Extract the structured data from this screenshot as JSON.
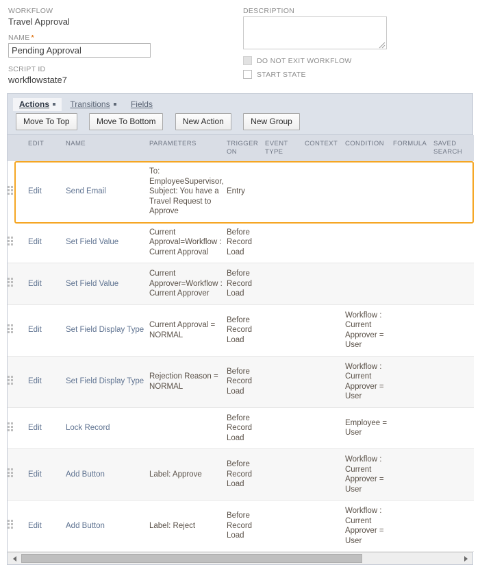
{
  "form": {
    "workflow_label": "WORKFLOW",
    "workflow_value": "Travel Approval",
    "name_label": "NAME",
    "name_required_mark": "*",
    "name_value": "Pending Approval",
    "name_placeholder": "",
    "script_id_label": "SCRIPT ID",
    "script_id_value": "workflowstate7",
    "description_label": "DESCRIPTION",
    "description_value": "",
    "description_placeholder": "",
    "checkboxes": [
      {
        "label": "DO NOT EXIT WORKFLOW",
        "checked": false,
        "disabled": true
      },
      {
        "label": "START STATE",
        "checked": false,
        "disabled": false
      }
    ]
  },
  "panel": {
    "tabs": [
      {
        "label": "Actions",
        "has_menu": true,
        "active": true
      },
      {
        "label": "Transitions",
        "has_menu": true,
        "active": false
      },
      {
        "label": "Fields",
        "has_menu": false,
        "active": false
      }
    ],
    "buttons": [
      {
        "label": "Move To Top"
      },
      {
        "label": "Move To Bottom"
      },
      {
        "label": "New Action"
      },
      {
        "label": "New Group"
      }
    ]
  },
  "table": {
    "columns": [
      "",
      "EDIT",
      "NAME",
      "PARAMETERS",
      "TRIGGER ON",
      "EVENT TYPE",
      "CONTEXT",
      "CONDITION",
      "FORMULA",
      "SAVED SEARCH"
    ],
    "rows": [
      {
        "edit": "Edit",
        "name": "Send Email",
        "parameters": "To: EmployeeSupervisor, Subject: You have a Travel Request to Approve",
        "trigger_on": "Entry",
        "event_type": "",
        "context": "",
        "condition": "",
        "formula": "",
        "saved_search": "",
        "highlighted": true
      },
      {
        "edit": "Edit",
        "name": "Set Field Value",
        "parameters": "Current Approval=Workflow : Current Approval",
        "trigger_on": "Before Record Load",
        "event_type": "",
        "context": "",
        "condition": "",
        "formula": "",
        "saved_search": "",
        "highlighted": false
      },
      {
        "edit": "Edit",
        "name": "Set Field Value",
        "parameters": "Current Approver=Workflow : Current Approver",
        "trigger_on": "Before Record Load",
        "event_type": "",
        "context": "",
        "condition": "",
        "formula": "",
        "saved_search": "",
        "highlighted": false
      },
      {
        "edit": "Edit",
        "name": "Set Field Display Type",
        "parameters": "Current Approval = NORMAL",
        "trigger_on": "Before Record Load",
        "event_type": "",
        "context": "",
        "condition": "Workflow : Current Approver = User",
        "formula": "",
        "saved_search": "",
        "highlighted": false
      },
      {
        "edit": "Edit",
        "name": "Set Field Display Type",
        "parameters": "Rejection Reason = NORMAL",
        "trigger_on": "Before Record Load",
        "event_type": "",
        "context": "",
        "condition": "Workflow : Current Approver = User",
        "formula": "",
        "saved_search": "",
        "highlighted": false
      },
      {
        "edit": "Edit",
        "name": "Lock Record",
        "parameters": "",
        "trigger_on": "Before Record Load",
        "event_type": "",
        "context": "",
        "condition": "Employee = User",
        "formula": "",
        "saved_search": "",
        "highlighted": false
      },
      {
        "edit": "Edit",
        "name": "Add Button",
        "parameters": "Label: Approve",
        "trigger_on": "Before Record Load",
        "event_type": "",
        "context": "",
        "condition": "Workflow : Current Approver = User",
        "formula": "",
        "saved_search": "",
        "highlighted": false
      },
      {
        "edit": "Edit",
        "name": "Add Button",
        "parameters": "Label: Reject",
        "trigger_on": "Before Record Load",
        "event_type": "",
        "context": "",
        "condition": "Workflow : Current Approver = User",
        "formula": "",
        "saved_search": "",
        "highlighted": false
      }
    ]
  },
  "scrollbar": {
    "orientation": "horizontal",
    "thumb_percent": 78
  },
  "colors": {
    "highlight": "#f5a623",
    "panel_bg": "#dde2ea",
    "header_bg": "#d9dde5",
    "link": "#5f7391",
    "required": "#e07b1f"
  }
}
